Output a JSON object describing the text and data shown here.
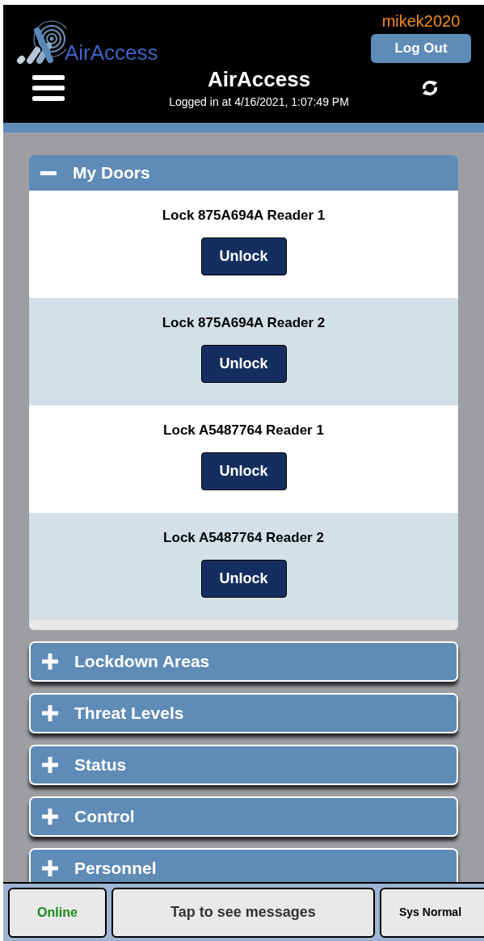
{
  "header": {
    "logo_text": "AirAccess",
    "username": "mikek2020",
    "logout_button": "Log Out",
    "title": "AirAccess",
    "login_info": "Logged in at 4/16/2021, 1:07:49 PM"
  },
  "sections": [
    {
      "title": "My Doors",
      "expanded": true,
      "doors": [
        {
          "name": "Lock 875A694A Reader 1",
          "button": "Unlock"
        },
        {
          "name": "Lock 875A694A Reader 2",
          "button": "Unlock"
        },
        {
          "name": "Lock A5487764 Reader 1",
          "button": "Unlock"
        },
        {
          "name": "Lock A5487764 Reader 2",
          "button": "Unlock"
        }
      ]
    },
    {
      "title": "Lockdown Areas",
      "expanded": false
    },
    {
      "title": "Threat Levels",
      "expanded": false
    },
    {
      "title": "Status",
      "expanded": false
    },
    {
      "title": "Control",
      "expanded": false
    },
    {
      "title": "Personnel",
      "expanded": false
    }
  ],
  "status_bar": {
    "connection": "Online",
    "messages": "Tap to see messages",
    "system": "Sys Normal"
  }
}
